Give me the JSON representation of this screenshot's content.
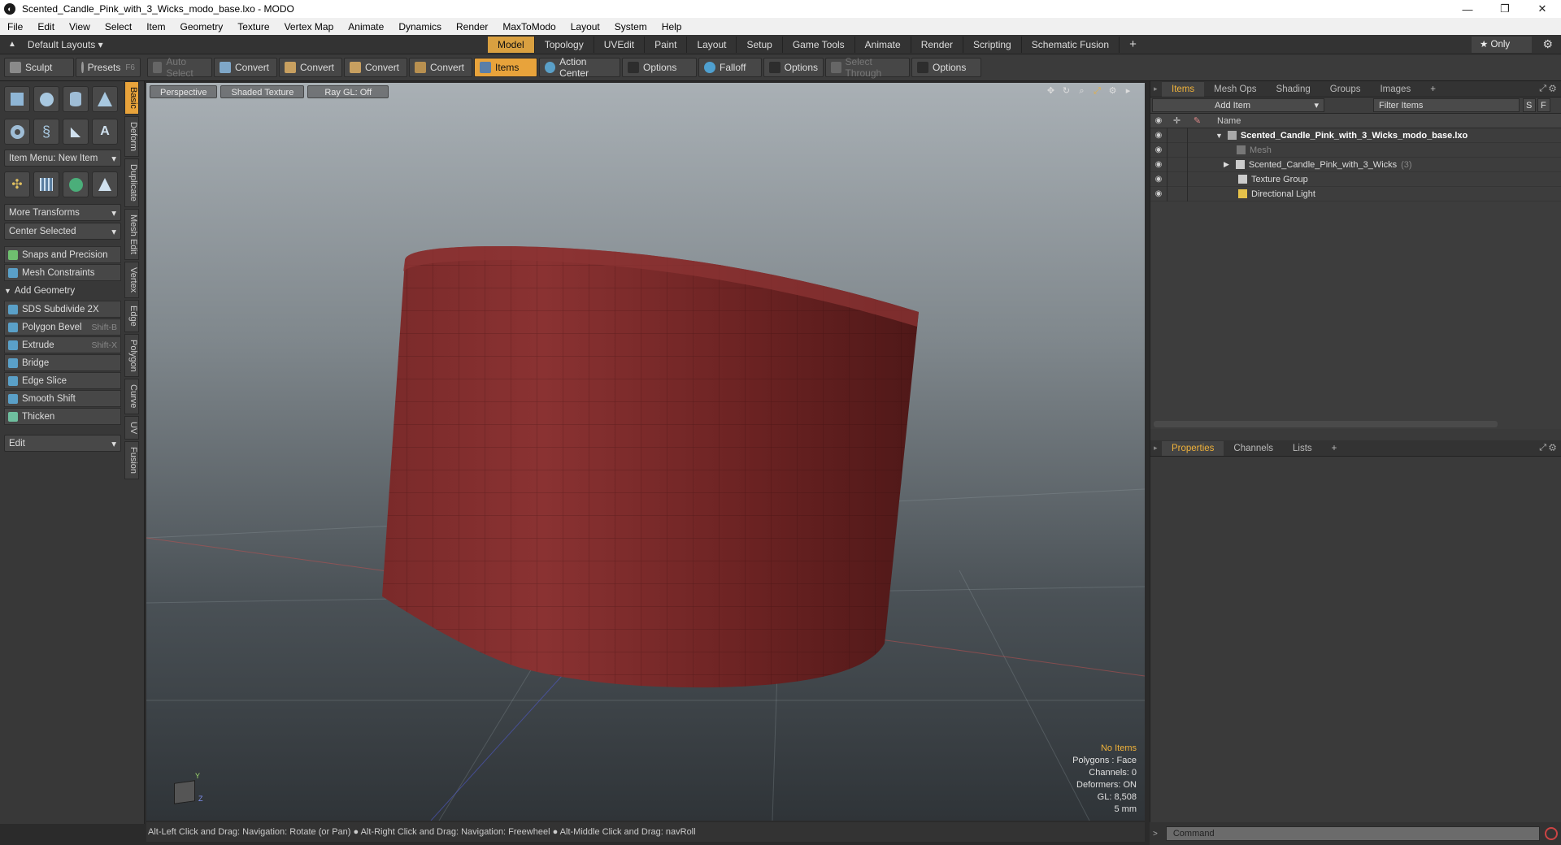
{
  "window": {
    "title": "Scented_Candle_Pink_with_3_Wicks_modo_base.lxo - MODO",
    "minimize": "—",
    "restore": "❐",
    "close": "✕"
  },
  "menu": [
    "File",
    "Edit",
    "View",
    "Select",
    "Item",
    "Geometry",
    "Texture",
    "Vertex Map",
    "Animate",
    "Dynamics",
    "Render",
    "MaxToModo",
    "Layout",
    "System",
    "Help"
  ],
  "layoutbar": {
    "layouts_label": "Default Layouts ▾",
    "tabs": [
      "Model",
      "Topology",
      "UVEdit",
      "Paint",
      "Layout",
      "Setup",
      "Game Tools",
      "Animate",
      "Render",
      "Scripting",
      "Schematic Fusion"
    ],
    "active_tab": "Model",
    "add": "+",
    "only": "★  Only"
  },
  "toolrow": {
    "sculpt": "Sculpt",
    "presets": "Presets",
    "presets_key": "F6",
    "auto_select": "Auto Select",
    "convert": "Convert",
    "items": "Items",
    "action_center": "Action Center",
    "options": "Options",
    "falloff": "Falloff",
    "select_through": "Select Through"
  },
  "leftpanel": {
    "item_menu": "Item Menu: New Item",
    "more_transforms": "More Transforms",
    "center_selected": "Center Selected",
    "snaps": "Snaps and Precision",
    "mesh_constraints": "Mesh Constraints",
    "add_geometry": "Add Geometry",
    "tools": [
      {
        "label": "SDS Subdivide 2X",
        "shortcut": ""
      },
      {
        "label": "Polygon Bevel",
        "shortcut": "Shift-B"
      },
      {
        "label": "Extrude",
        "shortcut": "Shift-X"
      },
      {
        "label": "Bridge",
        "shortcut": ""
      },
      {
        "label": "Edge Slice",
        "shortcut": ""
      },
      {
        "label": "Smooth Shift",
        "shortcut": ""
      },
      {
        "label": "Thicken",
        "shortcut": ""
      }
    ],
    "edit": "Edit"
  },
  "vtabs": [
    "Basic",
    "Deform",
    "Duplicate",
    "Mesh Edit",
    "Vertex",
    "Edge",
    "Polygon",
    "Curve",
    "UV",
    "Fusion"
  ],
  "viewport": {
    "tabs": [
      "Perspective",
      "Shaded Texture",
      "Ray GL: Off"
    ],
    "info": {
      "items": "No Items",
      "polygons": "Polygons : Face",
      "channels": "Channels: 0",
      "deformers": "Deformers: ON",
      "gl": "GL: 8,508",
      "scale": "5 mm"
    },
    "axis_y": "Y",
    "axis_z": "Z"
  },
  "status": "Alt-Left Click and Drag: Navigation: Rotate (or Pan) ● Alt-Right Click and Drag: Navigation: Freewheel ● Alt-Middle Click and Drag: navRoll",
  "rightpanel": {
    "tabs": [
      "Items",
      "Mesh Ops",
      "Shading",
      "Groups",
      "Images"
    ],
    "add_item": "Add Item",
    "filter": "Filter Items",
    "s_btn": "S",
    "f_btn": "F",
    "name_header": "Name",
    "tree": [
      {
        "label": "Scented_Candle_Pink_with_3_Wicks_modo_base.lxo",
        "bold": true,
        "indent": 0,
        "count": ""
      },
      {
        "label": "Mesh",
        "dim": true,
        "indent": 1,
        "count": ""
      },
      {
        "label": "Scented_Candle_Pink_with_3_Wicks",
        "indent": 1,
        "count": "(3)"
      },
      {
        "label": "Texture Group",
        "indent": 1,
        "count": ""
      },
      {
        "label": "Directional Light",
        "indent": 1,
        "count": ""
      }
    ],
    "prop_tabs": [
      "Properties",
      "Channels",
      "Lists"
    ],
    "command_placeholder": "Command"
  }
}
